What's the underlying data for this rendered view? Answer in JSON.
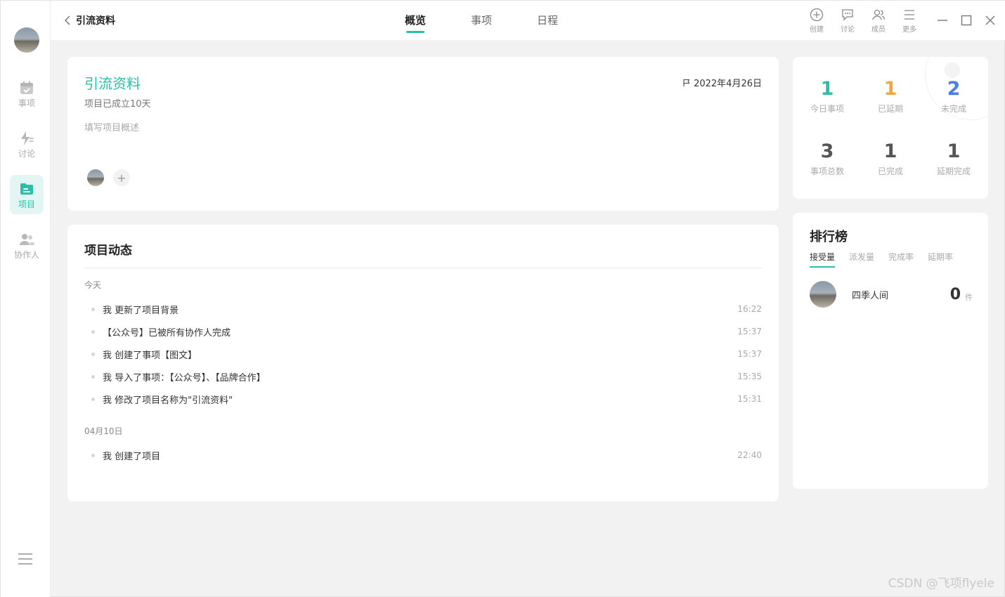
{
  "header": {
    "back_label": "引流资料",
    "tabs": [
      {
        "label": "概览",
        "active": true
      },
      {
        "label": "事项",
        "active": false
      },
      {
        "label": "日程",
        "active": false
      }
    ],
    "tools": [
      {
        "label": "创建",
        "icon": "plus-circle-icon"
      },
      {
        "label": "讨论",
        "icon": "chat-bubble-icon"
      },
      {
        "label": "成员",
        "icon": "members-icon"
      },
      {
        "label": "更多",
        "icon": "more-menu-icon"
      }
    ]
  },
  "sidebar": {
    "items": [
      {
        "label": "事项",
        "icon": "calendar-check-icon",
        "active": false
      },
      {
        "label": "讨论",
        "icon": "lightning-discuss-icon",
        "active": false
      },
      {
        "label": "项目",
        "icon": "folder-icon",
        "active": true
      },
      {
        "label": "协作人",
        "icon": "collaborators-icon",
        "active": false
      }
    ]
  },
  "project": {
    "title": "引流资料",
    "age": "项目已成立10天",
    "description_placeholder": "填写项目概述",
    "date": "2022年4月26日",
    "add_member_label": "+"
  },
  "activity": {
    "title": "项目动态",
    "groups": [
      {
        "label": "今天",
        "items": [
          {
            "text": "我 更新了项目背景",
            "time": "16:22"
          },
          {
            "text": "【公众号】已被所有协作人完成",
            "time": "15:37"
          },
          {
            "text": "我 创建了事项【图文】",
            "time": "15:37"
          },
          {
            "text": "我 导入了事项：【公众号】、【品牌合作】",
            "time": "15:35"
          },
          {
            "text": "我 修改了项目名称为\"引流资料\"",
            "time": "15:31"
          }
        ]
      },
      {
        "label": "04月10日",
        "items": [
          {
            "text": "我 创建了项目",
            "time": "22:40"
          }
        ]
      }
    ]
  },
  "stats": [
    {
      "value": "1",
      "label": "今日事项",
      "color": "#2bbfa8"
    },
    {
      "value": "1",
      "label": "已延期",
      "color": "#f2a93b"
    },
    {
      "value": "2",
      "label": "未完成",
      "color": "#4a7ee8"
    },
    {
      "value": "3",
      "label": "事项总数",
      "color": "#555555"
    },
    {
      "value": "1",
      "label": "已完成",
      "color": "#555555"
    },
    {
      "value": "1",
      "label": "延期完成",
      "color": "#555555"
    }
  ],
  "ranking": {
    "title": "排行榜",
    "tabs": [
      {
        "label": "接受量",
        "active": true
      },
      {
        "label": "派发量",
        "active": false
      },
      {
        "label": "完成率",
        "active": false
      },
      {
        "label": "延期率",
        "active": false
      }
    ],
    "rows": [
      {
        "name": "四季人间",
        "count": "0",
        "unit": "件"
      }
    ]
  },
  "watermark": "CSDN @飞项flyele",
  "colors": {
    "accent": "#2bbfa8",
    "warning": "#f2a93b",
    "info": "#4a7ee8"
  }
}
